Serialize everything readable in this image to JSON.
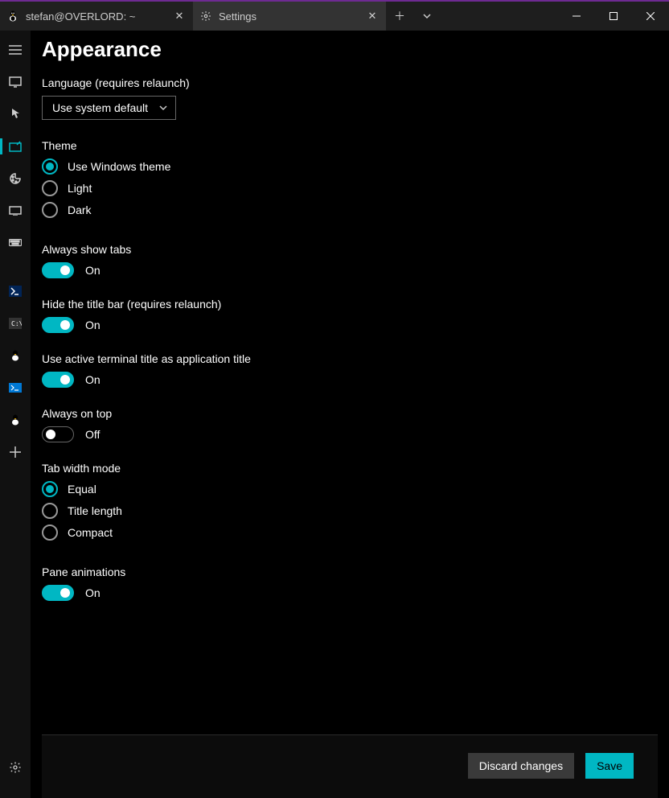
{
  "tabs": [
    {
      "label": "stefan@OVERLORD: ~",
      "icon": "tux"
    },
    {
      "label": "Settings",
      "icon": "gear"
    }
  ],
  "page": {
    "title": "Appearance"
  },
  "language": {
    "label": "Language (requires relaunch)",
    "value": "Use system default",
    "options": [
      "Use system default"
    ]
  },
  "theme": {
    "label": "Theme",
    "options": [
      "Use Windows theme",
      "Light",
      "Dark"
    ],
    "selected": "Use Windows theme"
  },
  "alwaysShowTabs": {
    "label": "Always show tabs",
    "value": true,
    "state": "On"
  },
  "hideTitleBar": {
    "label": "Hide the title bar (requires relaunch)",
    "value": true,
    "state": "On"
  },
  "useActiveTitle": {
    "label": "Use active terminal title as application title",
    "value": true,
    "state": "On"
  },
  "alwaysOnTop": {
    "label": "Always on top",
    "value": false,
    "state": "Off"
  },
  "tabWidthMode": {
    "label": "Tab width mode",
    "options": [
      "Equal",
      "Title length",
      "Compact"
    ],
    "selected": "Equal"
  },
  "paneAnimations": {
    "label": "Pane animations",
    "value": true,
    "state": "On"
  },
  "footer": {
    "discard": "Discard changes",
    "save": "Save"
  },
  "colors": {
    "accent": "#00b7c3"
  }
}
